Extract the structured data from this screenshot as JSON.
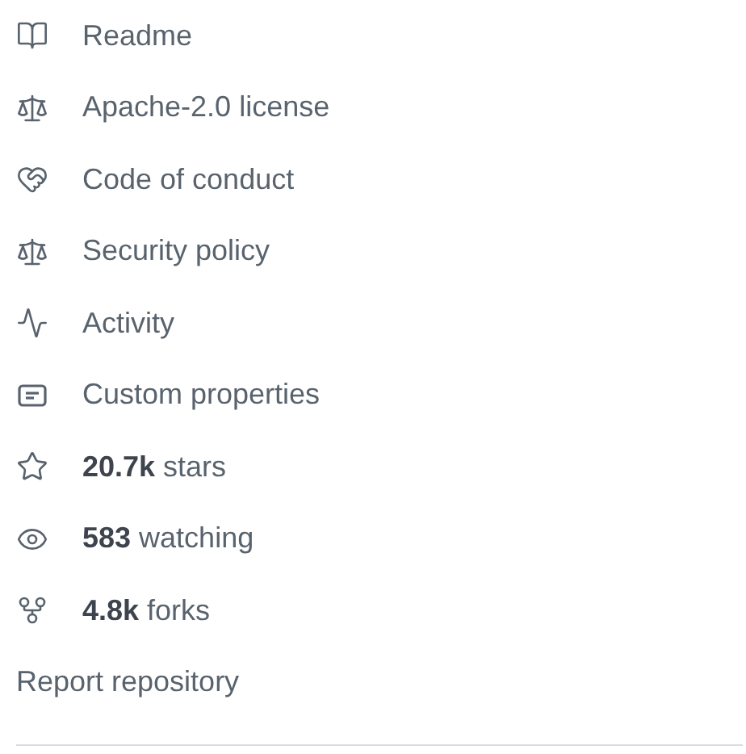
{
  "links": [
    {
      "text": "Readme"
    },
    {
      "text": "Apache-2.0 license"
    },
    {
      "text": "Code of conduct"
    },
    {
      "text": "Security policy"
    },
    {
      "text": "Activity"
    },
    {
      "text": "Custom properties"
    },
    {
      "text": "**20.7k** stars"
    },
    {
      "text": "**583** watching"
    },
    {
      "text": "**4.8k** forks"
    }
  ],
  "report": "Report repository"
}
